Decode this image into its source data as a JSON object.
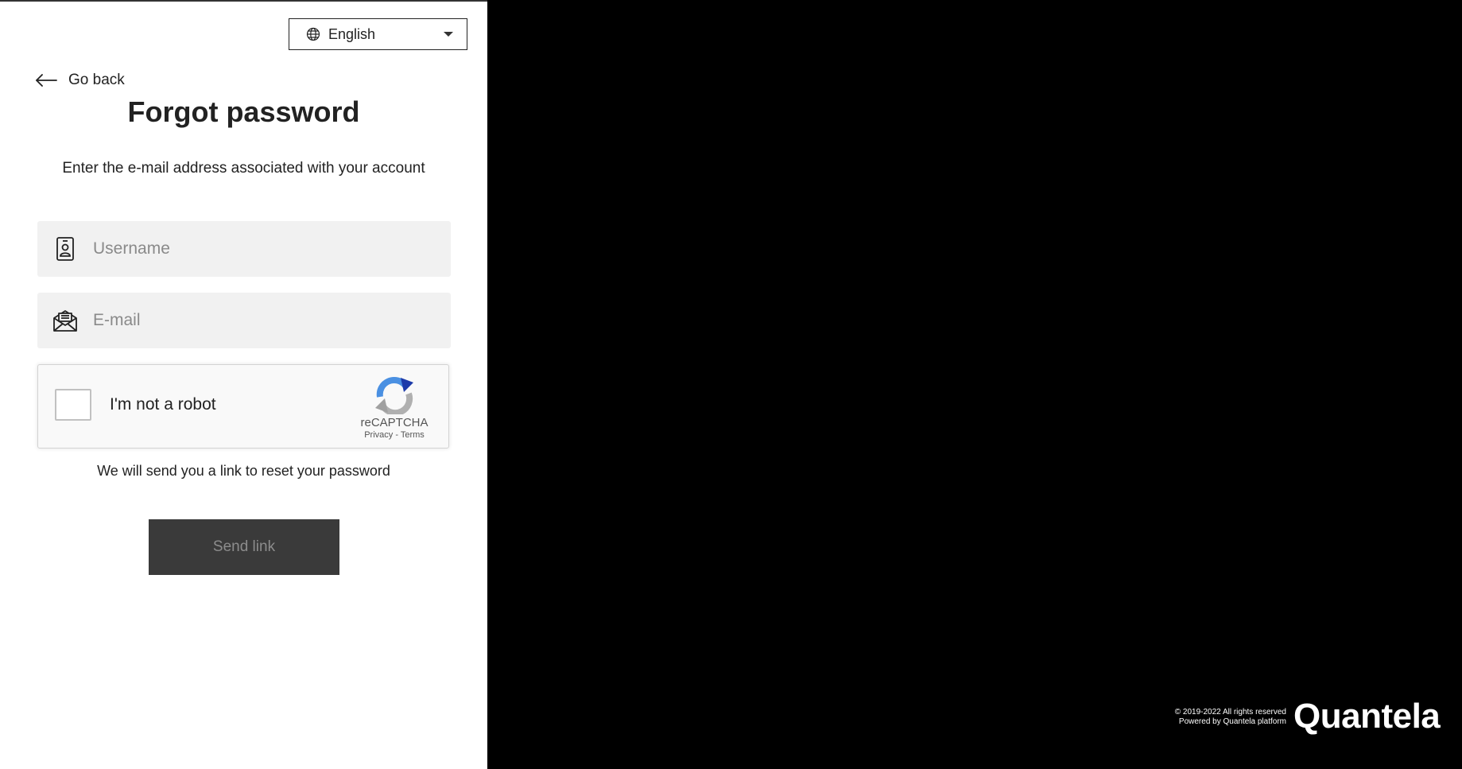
{
  "language_selector": {
    "icon": "globe-icon",
    "value": "English",
    "caret_icon": "chevron-down-icon"
  },
  "navigation": {
    "back_label": "Go back",
    "back_icon": "arrow-left-icon"
  },
  "form": {
    "title": "Forgot password",
    "subtitle": "Enter the e-mail address associated with your account",
    "username": {
      "placeholder": "Username",
      "value": "",
      "icon": "id-badge-icon"
    },
    "email": {
      "placeholder": "E-mail",
      "value": "",
      "icon": "open-envelope-icon"
    },
    "note": "We will send you a link to reset your password",
    "submit_label": "Send link"
  },
  "recaptcha": {
    "checkbox_label": "I'm not a robot",
    "checked": false,
    "brand": "reCAPTCHA",
    "privacy_label": "Privacy",
    "separator": "-",
    "terms_label": "Terms"
  },
  "footer": {
    "copyright": "© 2019-2022 All rights reserved",
    "powered_by": "Powered by Quantela platform",
    "logo_text": "Quantela"
  },
  "colors": {
    "panel_bg": "#ffffff",
    "background": "#000000",
    "field_bg": "#f1f1f1",
    "button_bg": "#3a3a3a",
    "button_text": "#8c8c8c",
    "text": "#222222"
  }
}
